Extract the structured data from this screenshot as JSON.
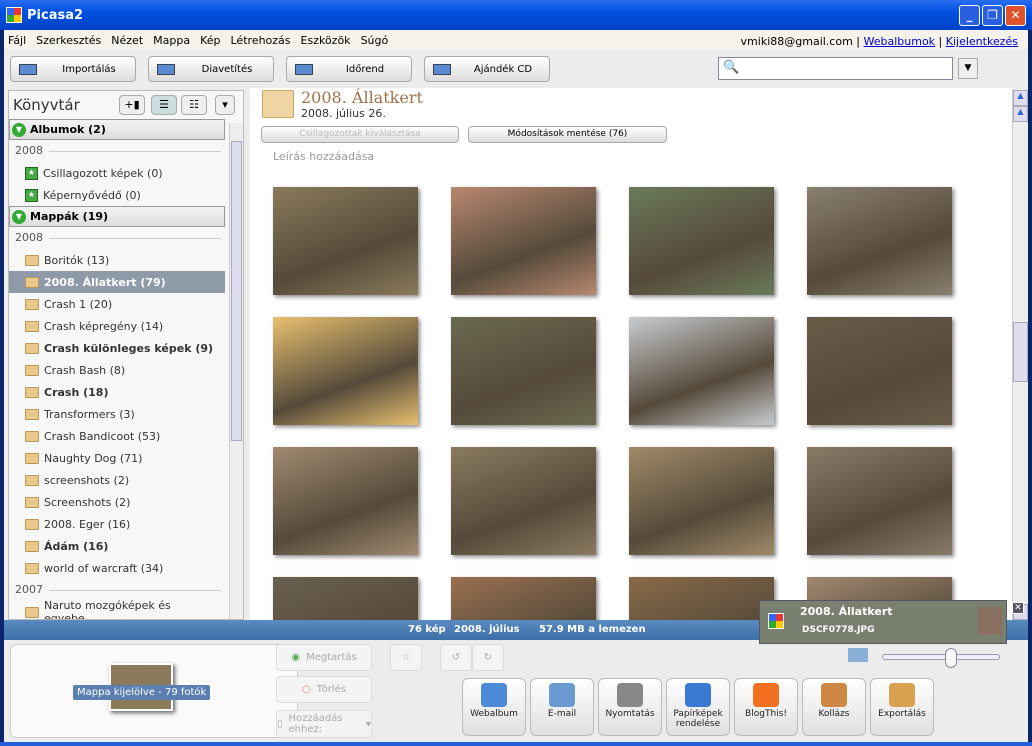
{
  "window": {
    "title": "Picasa2"
  },
  "menu": [
    "Fájl",
    "Szerkesztés",
    "Nézet",
    "Mappa",
    "Kép",
    "Létrehozás",
    "Eszközök",
    "Súgó"
  ],
  "account": {
    "email": "vmiki88@gmail.com",
    "webalbums": "Webalbumok",
    "logout": "Kijelentkezés"
  },
  "toolbar": [
    "Importálás",
    "Diavetítés",
    "Időrend",
    "Ajándék CD"
  ],
  "search": {
    "value": "",
    "placeholder": ""
  },
  "library": {
    "title": "Könyvtár",
    "albums_header": "Albumok (2)",
    "albums_year": "2008",
    "albums": [
      "Csillagozott képek (0)",
      "Képernyővédő (0)"
    ],
    "folders_header": "Mappák (19)",
    "folders_year": "2008",
    "folders": [
      {
        "label": "Boritók (13)",
        "bold": false,
        "selected": false
      },
      {
        "label": "2008. Állatkert (79)",
        "bold": true,
        "selected": true
      },
      {
        "label": "Crash 1 (20)",
        "bold": false,
        "selected": false
      },
      {
        "label": "Crash képregény (14)",
        "bold": false,
        "selected": false
      },
      {
        "label": "Crash különleges képek (9)",
        "bold": true,
        "selected": false
      },
      {
        "label": "Crash Bash (8)",
        "bold": false,
        "selected": false
      },
      {
        "label": "Crash (18)",
        "bold": true,
        "selected": false
      },
      {
        "label": "Transformers (3)",
        "bold": false,
        "selected": false
      },
      {
        "label": "Crash Bandicoot (53)",
        "bold": false,
        "selected": false
      },
      {
        "label": "Naughty Dog (71)",
        "bold": false,
        "selected": false
      },
      {
        "label": "screenshots (2)",
        "bold": false,
        "selected": false
      },
      {
        "label": "Screenshots (2)",
        "bold": false,
        "selected": false
      },
      {
        "label": "2008. Eger (16)",
        "bold": false,
        "selected": false
      },
      {
        "label": "Ádám (16)",
        "bold": true,
        "selected": false
      },
      {
        "label": "world of warcraft (34)",
        "bold": false,
        "selected": false
      }
    ],
    "year2": "2007",
    "folders2": [
      "Naruto mozgóképek és egyebe..."
    ]
  },
  "folder": {
    "title": "2008. Állatkert",
    "date": "2008. július 26.",
    "select_starred": "Csillagozottak kiválasztása",
    "save_changes": "Módosítások mentése (76)",
    "add_description": "Leírás hozzáadása"
  },
  "thumbnail_colors": [
    "#8a7a5a",
    "#b88870",
    "#6a7a5a",
    "#8a8070",
    "#e8c070",
    "#6a6a50",
    "#c8ccd0",
    "#6a5a48",
    "#a08a70",
    "#8a7a60",
    "#a08a68",
    "#8a7a68",
    "#6a6050",
    "#9a7050",
    "#8a6a48",
    "#a08870"
  ],
  "status": {
    "count": "76 kép",
    "date": "2008. július",
    "size": "57.9 MB a lemezen"
  },
  "notification": {
    "title": "2008. Állatkert",
    "file": "DSCF0778.JPG"
  },
  "tray": {
    "label": "Mappa kijelölve - 79 fotók",
    "keep": "Megtartás",
    "delete": "Törlés",
    "add_to": "Hozzáadás ehhez:"
  },
  "zoom_level": 0.6,
  "actions": [
    {
      "label": "Webalbum",
      "color": "#4a8ad8"
    },
    {
      "label": "E-mail",
      "color": "#6a9ad0"
    },
    {
      "label": "Nyomtatás",
      "color": "#888"
    },
    {
      "label": "Papírképek rendelése",
      "color": "#3a7ad0"
    },
    {
      "label": "BlogThis!",
      "color": "#f07020"
    },
    {
      "label": "Kollázs",
      "color": "#c84"
    },
    {
      "label": "Exportálás",
      "color": "#d9a050"
    }
  ]
}
